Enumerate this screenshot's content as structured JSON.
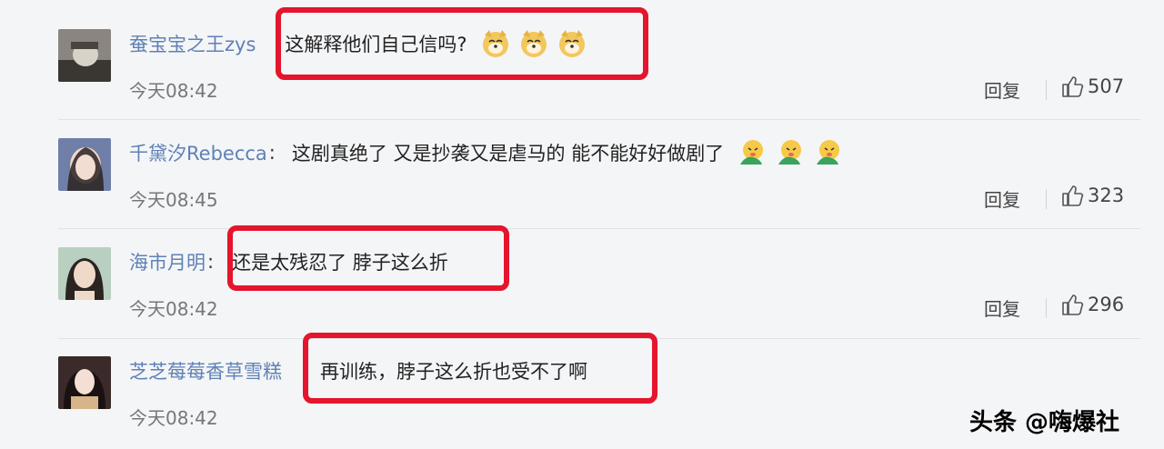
{
  "comments": [
    {
      "username": "蚕宝宝之王zys",
      "colon": "",
      "text": "这解释他们自己信吗?",
      "time": "今天08:42",
      "reply": "回复",
      "likes": "507",
      "emoji": "doge-emoji"
    },
    {
      "username": "千黛汐Rebecca",
      "colon": ":",
      "text": "这剧真绝了 又是抄袭又是虐马的 能不能好好做剧了",
      "time": "今天08:45",
      "reply": "回复",
      "likes": "323",
      "emoji": "vomit-emoji"
    },
    {
      "username": "海市月明",
      "colon": ":",
      "text": "还是太残忍了 脖子这么折",
      "time": "今天08:42",
      "reply": "回复",
      "likes": "296",
      "emoji": ""
    },
    {
      "username": "芝芝莓莓香草雪糕",
      "colon": "",
      "text": "再训练，脖子这么折也受不了啊",
      "time": "今天08:42",
      "reply": "",
      "likes": "",
      "emoji": ""
    }
  ],
  "watermark": "头条 @嗨爆社",
  "colors": {
    "username": "#5f81b6",
    "highlight": "#e4152c",
    "background": "#f4f5f7"
  }
}
